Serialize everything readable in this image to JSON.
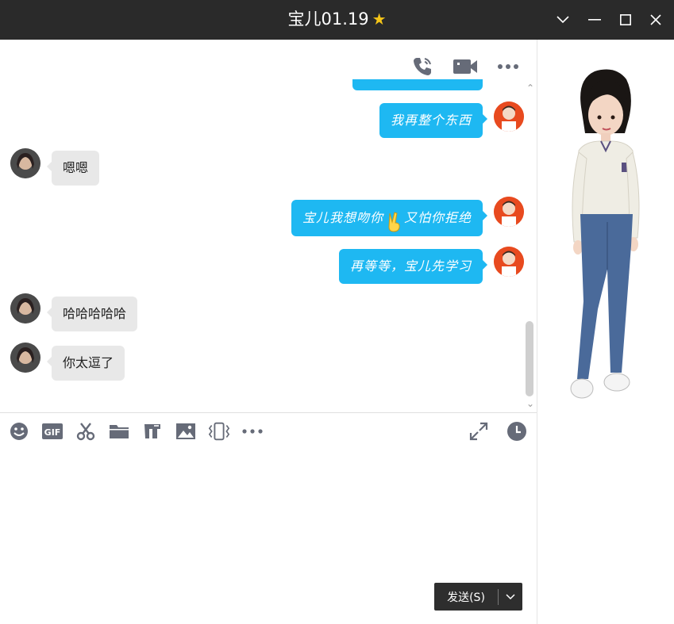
{
  "window": {
    "title": "宝儿01.19",
    "star": "★"
  },
  "messages": [
    {
      "side": "out",
      "text": "我再整个东西"
    },
    {
      "side": "in",
      "text": "嗯嗯"
    },
    {
      "side": "out",
      "text_before": "宝儿我想吻你",
      "emoji": "victory-hand",
      "text_after": "又怕你拒绝"
    },
    {
      "side": "out",
      "text": "再等等，宝儿先学习"
    },
    {
      "side": "in",
      "text": "哈哈哈哈哈"
    },
    {
      "side": "in",
      "text": "你太逗了"
    }
  ],
  "toolbar_top": [
    "phone-icon",
    "video-call-icon",
    "more-icon"
  ],
  "toolbar_bottom": [
    "emoji-icon",
    "gif-icon",
    "scissors-icon",
    "folder-icon",
    "font-icon",
    "image-icon",
    "shake-icon",
    "more-icon"
  ],
  "toolbar_bottom_right": [
    "expand-icon",
    "history-icon"
  ],
  "send": {
    "label": "发送(S)"
  },
  "colors": {
    "accent": "#1eb8f2",
    "titlebar": "#2a2a2a",
    "in_bubble": "#e8e8e8",
    "icon": "#666b78"
  }
}
